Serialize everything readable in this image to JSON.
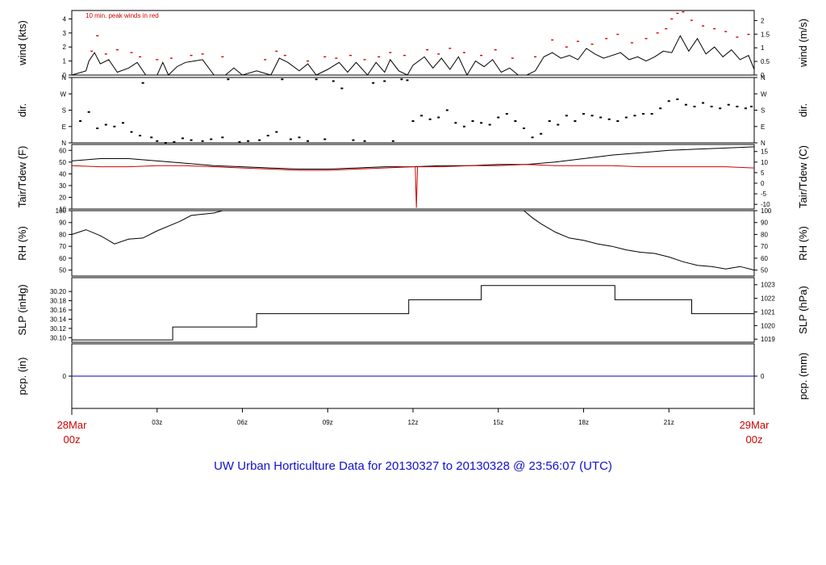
{
  "title": "UW Urban Horticulture Data for 20130327  to  20130328 @ 23:56:07  (UTC)",
  "x_axis": {
    "range_hours": [
      0,
      24
    ],
    "ticks": [
      {
        "h": 3,
        "label": "03z"
      },
      {
        "h": 6,
        "label": "06z"
      },
      {
        "h": 9,
        "label": "09z"
      },
      {
        "h": 12,
        "label": "12z"
      },
      {
        "h": 15,
        "label": "15z"
      },
      {
        "h": 18,
        "label": "18z"
      },
      {
        "h": 21,
        "label": "21z"
      }
    ],
    "start_label": {
      "date": "28Mar",
      "time": "00z"
    },
    "end_label": {
      "date": "29Mar",
      "time": "00z"
    }
  },
  "colors": {
    "primary": "#000000",
    "peak": "#d00000",
    "precip": "#0000cc",
    "title": "#1010d0",
    "date": "#d00000"
  },
  "chart_data": [
    {
      "id": "wind",
      "type": "line",
      "ylabel": "wind (kts)",
      "ylabel_right": "wind (m/s)",
      "ylim": [
        0,
        4.6
      ],
      "yticks": [
        0,
        1,
        2,
        3,
        4
      ],
      "yticks_right": [
        {
          "v": 0,
          "label": "0"
        },
        {
          "v": 0.972,
          "label": "0.5"
        },
        {
          "v": 1.944,
          "label": "1"
        },
        {
          "v": 2.916,
          "label": "1.5"
        },
        {
          "v": 3.888,
          "label": "2"
        }
      ],
      "note": "10 min. peak winds in red",
      "series": [
        {
          "style": "line",
          "color": "#000000",
          "x": [
            0,
            0.5,
            0.6,
            0.8,
            1.0,
            1.3,
            1.6,
            2.0,
            2.3,
            2.6,
            3.0,
            3.2,
            3.4,
            3.7,
            4.0,
            4.3,
            4.6,
            5.0,
            5.4,
            5.7,
            6.0,
            6.5,
            7.0,
            7.3,
            7.6,
            8.0,
            8.3,
            8.6,
            9.0,
            9.4,
            9.7,
            10.0,
            10.4,
            10.7,
            11.0,
            11.2,
            11.5,
            11.8,
            12.0,
            12.4,
            12.7,
            13.0,
            13.3,
            13.6,
            13.9,
            14.2,
            14.5,
            14.8,
            15.1,
            15.4,
            15.7,
            16.0,
            16.3,
            16.6,
            16.9,
            17.2,
            17.5,
            17.8,
            18.1,
            18.4,
            18.7,
            19.0,
            19.3,
            19.6,
            19.9,
            20.2,
            20.5,
            20.8,
            21.1,
            21.4,
            21.7,
            22.0,
            22.3,
            22.6,
            22.9,
            23.2,
            23.5,
            23.8,
            24.0
          ],
          "y": [
            0,
            0.3,
            1.0,
            1.6,
            0.8,
            1.1,
            0.2,
            0.5,
            0.9,
            0,
            0,
            0.9,
            0,
            0.6,
            0.9,
            1.0,
            1.1,
            0,
            0,
            0.5,
            0,
            0.3,
            0,
            1.2,
            0.9,
            0.3,
            0.8,
            0,
            0.4,
            0.9,
            0.2,
            0.9,
            0,
            0.9,
            0.2,
            1.1,
            0.3,
            0,
            0.7,
            1.3,
            0.5,
            1.2,
            0.4,
            1.3,
            0,
            1.0,
            0.6,
            1.1,
            0.2,
            0.5,
            0,
            0,
            0.3,
            1.3,
            1.6,
            1.2,
            1.4,
            1.1,
            1.9,
            1.5,
            1.2,
            1.4,
            1.6,
            1.1,
            1.3,
            1.0,
            1.3,
            1.7,
            1.6,
            2.8,
            1.7,
            2.6,
            1.5,
            2.0,
            1.3,
            1.8,
            1.1,
            1.4,
            0.4
          ]
        },
        {
          "style": "marker",
          "color": "#d00000",
          "x": [
            0.7,
            0.9,
            1.2,
            1.6,
            2.1,
            2.4,
            3.0,
            3.5,
            4.2,
            4.6,
            5.3,
            6.8,
            7.2,
            7.5,
            8.3,
            8.9,
            9.3,
            9.8,
            10.3,
            10.8,
            11.2,
            11.7,
            12.5,
            12.9,
            13.3,
            13.8,
            14.4,
            14.9,
            15.5,
            16.3,
            16.9,
            17.4,
            17.8,
            18.3,
            18.8,
            19.2,
            19.7,
            20.2,
            20.6,
            20.9,
            21.1,
            21.3,
            21.5,
            21.8,
            22.2,
            22.6,
            23.0,
            23.4,
            23.8
          ],
          "y": [
            1.7,
            2.8,
            1.5,
            1.8,
            1.6,
            1.3,
            1.1,
            1.2,
            1.4,
            1.5,
            1.3,
            1.1,
            1.7,
            1.4,
            1.0,
            1.3,
            1.2,
            1.4,
            1.1,
            1.3,
            1.6,
            1.4,
            1.8,
            1.5,
            1.9,
            1.6,
            1.4,
            1.8,
            1.2,
            1.3,
            2.5,
            2.0,
            2.4,
            2.2,
            2.6,
            2.9,
            2.3,
            2.6,
            3.0,
            3.3,
            4.0,
            4.4,
            4.5,
            3.9,
            3.5,
            3.3,
            3.1,
            2.7,
            2.9
          ]
        }
      ]
    },
    {
      "id": "dir",
      "type": "scatter",
      "ylabel": "dir.",
      "ylabel_right": "dir.",
      "ylim": [
        0,
        360
      ],
      "yticks": [
        {
          "v": 0,
          "label": "N"
        },
        {
          "v": 90,
          "label": "E"
        },
        {
          "v": 180,
          "label": "S"
        },
        {
          "v": 270,
          "label": "W"
        },
        {
          "v": 360,
          "label": "N"
        }
      ],
      "series": [
        {
          "style": "dot",
          "color": "#000000",
          "x": [
            0.3,
            0.6,
            0.9,
            1.2,
            1.5,
            1.8,
            2.1,
            2.4,
            2.5,
            2.8,
            3.0,
            3.3,
            3.6,
            3.9,
            4.2,
            4.6,
            4.9,
            5.3,
            5.5,
            5.9,
            6.2,
            6.6,
            6.9,
            7.2,
            7.4,
            7.7,
            8.0,
            8.3,
            8.6,
            8.9,
            9.2,
            9.5,
            9.9,
            10.3,
            10.6,
            11.0,
            11.3,
            11.6,
            11.8,
            12.0,
            12.3,
            12.6,
            12.9,
            13.2,
            13.5,
            13.8,
            14.1,
            14.4,
            14.7,
            15.0,
            15.3,
            15.6,
            15.9,
            16.2,
            16.5,
            16.8,
            17.1,
            17.4,
            17.7,
            18.0,
            18.3,
            18.6,
            18.9,
            19.2,
            19.5,
            19.8,
            20.1,
            20.4,
            20.7,
            21.0,
            21.3,
            21.6,
            21.9,
            22.2,
            22.5,
            22.8,
            23.1,
            23.4,
            23.7,
            23.9
          ],
          "y": [
            120,
            170,
            80,
            100,
            90,
            110,
            60,
            40,
            330,
            30,
            10,
            0,
            5,
            25,
            15,
            10,
            20,
            30,
            350,
            5,
            10,
            15,
            40,
            60,
            350,
            20,
            30,
            10,
            350,
            20,
            340,
            300,
            15,
            10,
            330,
            340,
            10,
            350,
            345,
            120,
            150,
            130,
            140,
            180,
            110,
            90,
            120,
            110,
            100,
            140,
            160,
            120,
            80,
            30,
            50,
            120,
            100,
            150,
            120,
            160,
            150,
            140,
            130,
            120,
            140,
            150,
            160,
            160,
            190,
            230,
            240,
            210,
            200,
            220,
            200,
            190,
            210,
            200,
            190,
            200
          ]
        }
      ]
    },
    {
      "id": "temp",
      "type": "line",
      "ylabel": "Tair/Tdew (F)",
      "ylabel_right": "Tair/Tdew (C)",
      "ylim": [
        10,
        65
      ],
      "yticks": [
        10,
        20,
        30,
        40,
        50,
        60
      ],
      "yticks_right": [
        {
          "v": 14,
          "label": "-10"
        },
        {
          "v": 23,
          "label": "-5"
        },
        {
          "v": 32,
          "label": "0"
        },
        {
          "v": 41,
          "label": "5"
        },
        {
          "v": 50,
          "label": "10"
        },
        {
          "v": 59,
          "label": "15"
        }
      ],
      "series": [
        {
          "name": "Tair",
          "color": "#000000",
          "x": [
            0,
            1,
            2,
            3,
            4,
            5,
            6,
            7,
            8,
            9,
            10,
            11,
            12,
            13,
            14,
            15,
            16,
            17,
            18,
            19,
            20,
            21,
            22,
            23,
            24
          ],
          "y": [
            51,
            53,
            53,
            51,
            49,
            47,
            46,
            45,
            44,
            44,
            45,
            46,
            46,
            47,
            47,
            48,
            48,
            50,
            53,
            56,
            58,
            60,
            61,
            62,
            63
          ]
        },
        {
          "name": "Tdew",
          "color": "#d00000",
          "x": [
            0,
            1,
            2,
            3,
            4,
            5,
            6,
            7,
            8,
            9,
            10,
            11,
            12,
            12.08,
            12.12,
            12.16,
            13,
            14,
            15,
            16,
            17,
            18,
            19,
            20,
            21,
            22,
            23,
            24
          ],
          "y": [
            47,
            46,
            46,
            47,
            47,
            46,
            45,
            44,
            43,
            43,
            44,
            45,
            46,
            46,
            11,
            46,
            46,
            47,
            47,
            48,
            47,
            47,
            47,
            46,
            46,
            46,
            46,
            45
          ]
        }
      ]
    },
    {
      "id": "rh",
      "type": "line",
      "ylabel": "RH (%)",
      "ylabel_right": "RH (%)",
      "ylim": [
        45,
        100
      ],
      "yticks": [
        50,
        60,
        70,
        80,
        90,
        100
      ],
      "series": [
        {
          "color": "#000000",
          "x": [
            0,
            0.5,
            1.0,
            1.5,
            2.0,
            2.5,
            3.0,
            3.5,
            3.8,
            4.2,
            4.6,
            5.0,
            5.3,
            15.9,
            16.2,
            16.5,
            17.0,
            17.5,
            18.0,
            18.5,
            19.0,
            19.5,
            20.0,
            20.5,
            21.0,
            21.5,
            22.0,
            22.5,
            23.0,
            23.5,
            24.0
          ],
          "y": [
            80,
            84,
            79,
            72,
            76,
            77,
            83,
            88,
            91,
            96,
            97,
            98,
            100,
            100,
            94,
            89,
            82,
            77,
            75,
            72,
            70,
            67,
            65,
            64,
            61,
            57,
            54,
            53,
            51,
            53,
            50
          ]
        }
      ]
    },
    {
      "id": "slp",
      "type": "line",
      "ylabel": "SLP (inHg)",
      "ylabel_right": "SLP (hPa)",
      "ylim": [
        30.09,
        30.23
      ],
      "yticks": [
        30.1,
        30.12,
        30.14,
        30.16,
        30.18,
        30.2
      ],
      "ytick_labels": [
        "30.10",
        "30.12",
        "30.14",
        "30.16",
        "30.18",
        "30.20"
      ],
      "yticks_right": [
        {
          "v": 30.0966,
          "label": "1019"
        },
        {
          "v": 30.1261,
          "label": "1020"
        },
        {
          "v": 30.1557,
          "label": "1021"
        },
        {
          "v": 30.1852,
          "label": "1022"
        },
        {
          "v": 30.2147,
          "label": "1023"
        }
      ],
      "series": [
        {
          "color": "#000000",
          "step": true,
          "x": [
            0,
            3.55,
            3.55,
            6.5,
            6.5,
            11.85,
            11.85,
            14.4,
            14.4,
            19.1,
            19.1,
            21.8,
            21.8,
            24
          ],
          "y": [
            30.095,
            30.095,
            30.123,
            30.123,
            30.152,
            30.152,
            30.182,
            30.182,
            30.213,
            30.213,
            30.182,
            30.182,
            30.152,
            30.152
          ]
        }
      ]
    },
    {
      "id": "pcp",
      "type": "line",
      "ylabel": "pcp. (in)",
      "ylabel_right": "pcp. (mm)",
      "ylim": [
        -1,
        1
      ],
      "yticks": [
        0
      ],
      "yticks_right": [
        {
          "v": 0,
          "label": "0"
        }
      ],
      "series": [
        {
          "color": "#0000cc",
          "x": [
            0,
            24
          ],
          "y": [
            0,
            0
          ]
        }
      ]
    }
  ]
}
